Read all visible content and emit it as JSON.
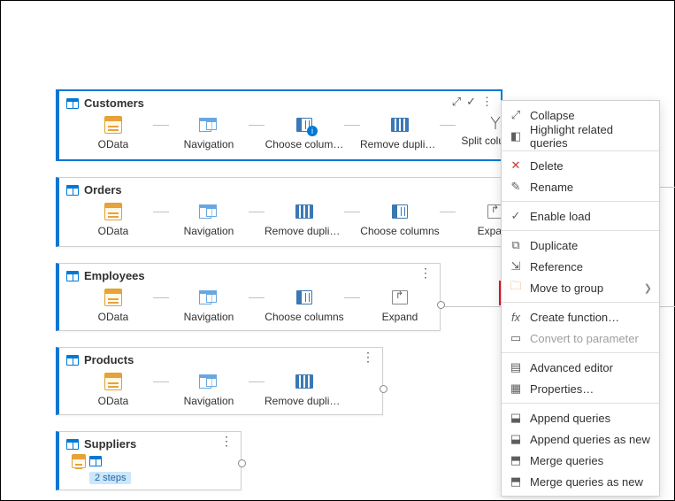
{
  "queries": {
    "customers": {
      "title": "Customers",
      "steps": [
        "OData",
        "Navigation",
        "Choose colum…",
        "Remove duplicat…",
        "Split column…"
      ]
    },
    "orders": {
      "title": "Orders",
      "steps": [
        "OData",
        "Navigation",
        "Remove duplicat…",
        "Choose columns",
        "Expand"
      ]
    },
    "employees": {
      "title": "Employees",
      "steps": [
        "OData",
        "Navigation",
        "Choose columns",
        "Expand"
      ]
    },
    "products": {
      "title": "Products",
      "steps": [
        "OData",
        "Navigation",
        "Remove duplicat…"
      ]
    },
    "suppliers": {
      "title": "Suppliers",
      "badge": "2 steps"
    }
  },
  "menu": {
    "collapse": "Collapse",
    "highlight": "Highlight related queries",
    "delete": "Delete",
    "rename": "Rename",
    "enableLoad": "Enable load",
    "duplicate": "Duplicate",
    "reference": "Reference",
    "moveGroup": "Move to group",
    "createFunc": "Create function…",
    "convertParam": "Convert to parameter",
    "advEditor": "Advanced editor",
    "properties": "Properties…",
    "appendQ": "Append queries",
    "appendNew": "Append queries as new",
    "mergeQ": "Merge queries",
    "mergeNew": "Merge queries as new"
  }
}
